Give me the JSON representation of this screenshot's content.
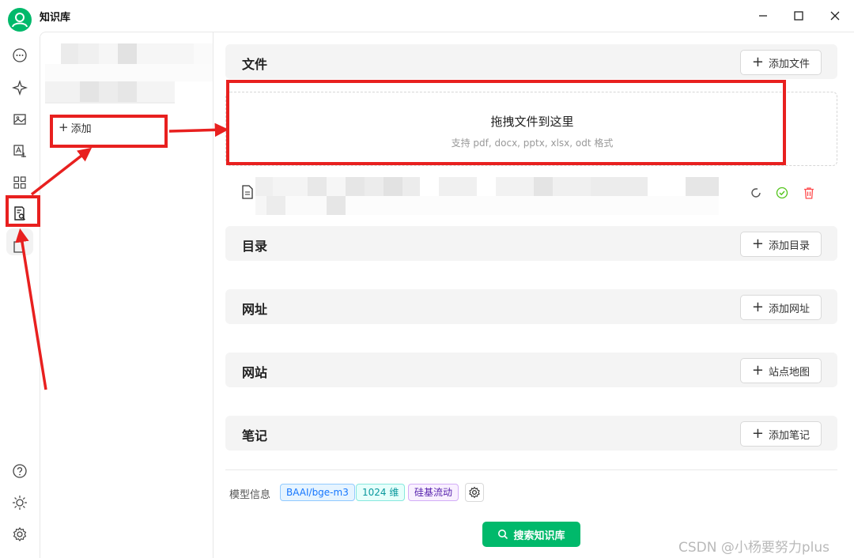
{
  "window": {
    "title": "知识库"
  },
  "sidebar": {
    "add_label": "添加"
  },
  "sections": [
    {
      "title": "文件",
      "button_label": "添加文件"
    },
    {
      "title": "目录",
      "button_label": "添加目录"
    },
    {
      "title": "网址",
      "button_label": "添加网址"
    },
    {
      "title": "网站",
      "button_label": "站点地图"
    },
    {
      "title": "笔记",
      "button_label": "添加笔记"
    }
  ],
  "dropzone": {
    "title": "拖拽文件到这里",
    "subtitle": "支持 pdf, docx, pptx, xlsx, odt 格式"
  },
  "model_info": {
    "label": "模型信息",
    "model": "BAAI/bge-m3",
    "dimensions": "1024 维",
    "provider": "硅基流动"
  },
  "search_button": {
    "label": "搜索知识库"
  },
  "watermark": "CSDN @小杨要努力plus",
  "colors": {
    "brand_green": "#00b96b",
    "annotation_red": "#e8201f",
    "check_green": "#52c41a",
    "delete_red": "#ff4d4f"
  }
}
